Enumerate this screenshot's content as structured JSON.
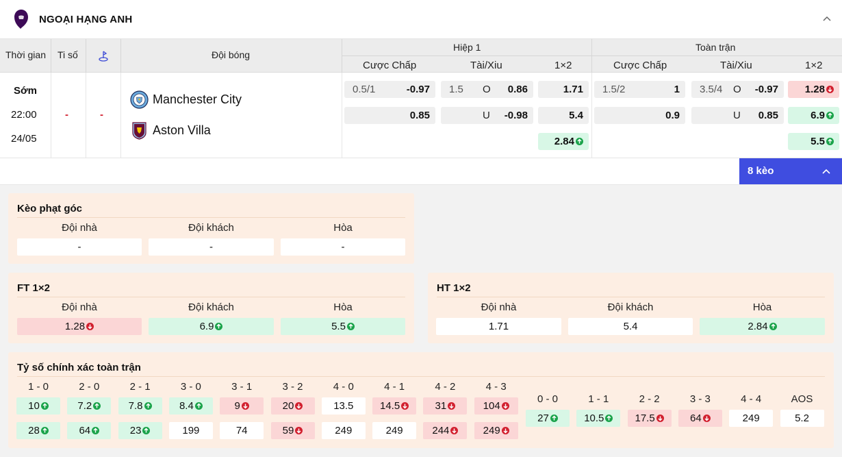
{
  "league": {
    "title": "NGOẠI HẠNG ANH"
  },
  "columns": {
    "time": "Thời gian",
    "score": "Ti số",
    "team": "Đội bóng",
    "half1": "Hiệp 1",
    "full": "Toàn trận",
    "handicap": "Cược Chấp",
    "overunder": "Tài/Xiu",
    "one_x_two": "1×2"
  },
  "match": {
    "status": "Sớm",
    "time": "22:00",
    "date": "24/05",
    "score_home": "-",
    "score_away": "-",
    "home": "Manchester City",
    "away": "Aston Villa",
    "half1": {
      "handicap_line": "0.5/1",
      "handicap_home": "-0.97",
      "handicap_away": "0.85",
      "ou_line": "1.5",
      "ou_over_label": "O",
      "ou_over": "0.86",
      "ou_under_label": "U",
      "ou_under": "-0.98",
      "x12_home": "1.71",
      "x12_away": "5.4",
      "x12_draw": "2.84"
    },
    "full": {
      "handicap_line": "1.5/2",
      "handicap_home": "1",
      "handicap_away": "0.9",
      "ou_line": "3.5/4",
      "ou_over_label": "O",
      "ou_over": "-0.97",
      "ou_under_label": "U",
      "ou_under": "0.85",
      "x12_home": "1.28",
      "x12_away": "6.9",
      "x12_draw": "5.5"
    }
  },
  "keo_button": "8 kèo",
  "corner": {
    "title": "Kèo phạt góc",
    "labels": [
      "Đội nhà",
      "Đội khách",
      "Hòa"
    ],
    "values": [
      "-",
      "-",
      "-"
    ]
  },
  "ft": {
    "title": "FT 1×2",
    "labels": [
      "Đội nhà",
      "Đội khách",
      "Hòa"
    ],
    "values": [
      "1.28",
      "6.9",
      "5.5"
    ]
  },
  "ht": {
    "title": "HT 1×2",
    "labels": [
      "Đội nhà",
      "Đội khách",
      "Hòa"
    ],
    "values": [
      "1.71",
      "5.4",
      "2.84"
    ]
  },
  "exact": {
    "title": "Tỷ số chính xác toàn trận",
    "left_labels": [
      "1 - 0",
      "2 - 0",
      "2 - 1",
      "3 - 0",
      "3 - 1",
      "3 - 2",
      "4 - 0",
      "4 - 1",
      "4 - 2",
      "4 - 3"
    ],
    "left_row1": [
      "10",
      "7.2",
      "7.8",
      "8.4",
      "9",
      "20",
      "13.5",
      "14.5",
      "31",
      "104"
    ],
    "left_row2": [
      "28",
      "64",
      "23",
      "199",
      "74",
      "59",
      "249",
      "249",
      "244",
      "249"
    ],
    "right_labels": [
      "0 - 0",
      "1 - 1",
      "2 - 2",
      "3 - 3",
      "4 - 4",
      "AOS"
    ],
    "right_values": [
      "27",
      "10.5",
      "17.5",
      "64",
      "249",
      "5.2"
    ]
  },
  "colors": {
    "accent_blue": "#3f4de0",
    "up_green": "#1aa34a",
    "down_red": "#d2202f",
    "league_purple": "#3d0a57"
  }
}
